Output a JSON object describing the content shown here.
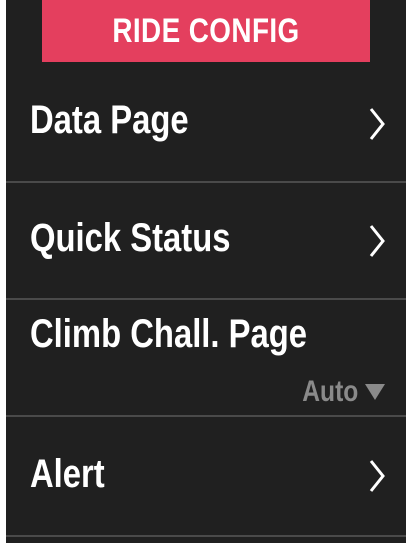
{
  "header": {
    "title": "RIDE CONFIG"
  },
  "menu": {
    "items": [
      {
        "label": "Data Page",
        "icon": "chevron-right-icon"
      },
      {
        "label": "Quick Status",
        "icon": "chevron-right-icon"
      },
      {
        "label": "Climb Chall. Page",
        "value": "Auto",
        "icon": "triangle-down-icon"
      },
      {
        "label": "Alert",
        "icon": "chevron-right-icon"
      }
    ]
  },
  "colors": {
    "header_bg": "#e43f5e",
    "screen_bg": "#202020",
    "text": "#ffffff",
    "muted_text": "#8a8a8a",
    "divider": "#4a4a4a"
  }
}
